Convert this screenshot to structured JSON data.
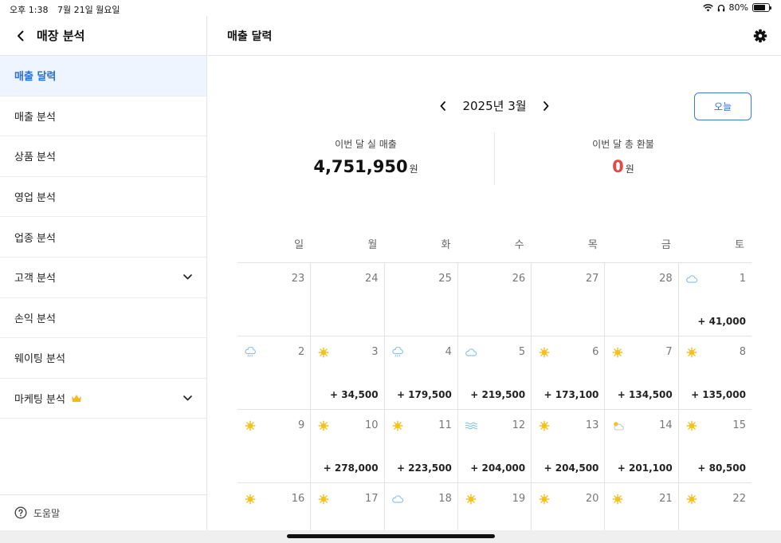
{
  "status_bar": {
    "time": "오후 1:38",
    "date": "7월 21일 월요일",
    "battery": "80%",
    "battery_level": 0.8
  },
  "sidebar": {
    "title": "매장 분석",
    "items": [
      {
        "label": "매출 달력",
        "active": true,
        "chevron": false,
        "crown": false
      },
      {
        "label": "매출 분석",
        "active": false,
        "chevron": false,
        "crown": false
      },
      {
        "label": "상품 분석",
        "active": false,
        "chevron": false,
        "crown": false
      },
      {
        "label": "영업 분석",
        "active": false,
        "chevron": false,
        "crown": false
      },
      {
        "label": "업종 분석",
        "active": false,
        "chevron": false,
        "crown": false
      },
      {
        "label": "고객 분석",
        "active": false,
        "chevron": true,
        "crown": false
      },
      {
        "label": "손익 분석",
        "active": false,
        "chevron": false,
        "crown": false
      },
      {
        "label": "웨이팅 분석",
        "active": false,
        "chevron": false,
        "crown": false
      },
      {
        "label": "마케팅 분석",
        "active": false,
        "chevron": true,
        "crown": true
      }
    ],
    "help_label": "도움말"
  },
  "main": {
    "title": "매출 달력",
    "month_label": "2025년 3월",
    "today_label": "오늘",
    "summary": {
      "sales_caption": "이번 달 실 매출",
      "sales_value": "4,751,950",
      "refund_caption": "이번 달 총 환불",
      "refund_value": "0",
      "unit": "원"
    },
    "weekdays": [
      "일",
      "월",
      "화",
      "수",
      "목",
      "금",
      "토"
    ],
    "calendar": [
      [
        {
          "day": "23",
          "weather": "",
          "amount": ""
        },
        {
          "day": "24",
          "weather": "",
          "amount": ""
        },
        {
          "day": "25",
          "weather": "",
          "amount": ""
        },
        {
          "day": "26",
          "weather": "",
          "amount": ""
        },
        {
          "day": "27",
          "weather": "",
          "amount": ""
        },
        {
          "day": "28",
          "weather": "",
          "amount": ""
        },
        {
          "day": "1",
          "weather": "cloud",
          "amount": "+ 41,000"
        }
      ],
      [
        {
          "day": "2",
          "weather": "rain",
          "amount": ""
        },
        {
          "day": "3",
          "weather": "sun",
          "amount": "+ 34,500"
        },
        {
          "day": "4",
          "weather": "rain",
          "amount": "+ 179,500"
        },
        {
          "day": "5",
          "weather": "cloud",
          "amount": "+ 219,500"
        },
        {
          "day": "6",
          "weather": "sun",
          "amount": "+ 173,100"
        },
        {
          "day": "7",
          "weather": "sun",
          "amount": "+ 134,500"
        },
        {
          "day": "8",
          "weather": "sun",
          "amount": "+ 135,000"
        }
      ],
      [
        {
          "day": "9",
          "weather": "sun",
          "amount": ""
        },
        {
          "day": "10",
          "weather": "sun",
          "amount": "+ 278,000"
        },
        {
          "day": "11",
          "weather": "sun",
          "amount": "+ 223,500"
        },
        {
          "day": "12",
          "weather": "fog",
          "amount": "+ 204,000"
        },
        {
          "day": "13",
          "weather": "sun",
          "amount": "+ 204,500"
        },
        {
          "day": "14",
          "weather": "partly",
          "amount": "+ 201,100"
        },
        {
          "day": "15",
          "weather": "sun",
          "amount": "+ 80,500"
        }
      ],
      [
        {
          "day": "16",
          "weather": "sun",
          "amount": ""
        },
        {
          "day": "17",
          "weather": "sun",
          "amount": ""
        },
        {
          "day": "18",
          "weather": "cloud",
          "amount": ""
        },
        {
          "day": "19",
          "weather": "sun",
          "amount": ""
        },
        {
          "day": "20",
          "weather": "sun",
          "amount": ""
        },
        {
          "day": "21",
          "weather": "sun",
          "amount": ""
        },
        {
          "day": "22",
          "weather": "sun",
          "amount": ""
        }
      ]
    ]
  },
  "colors": {
    "accent": "#2c6fd6",
    "refund": "#e54848",
    "sun": "#f5c21b",
    "cloud": "#8fc4ea"
  }
}
